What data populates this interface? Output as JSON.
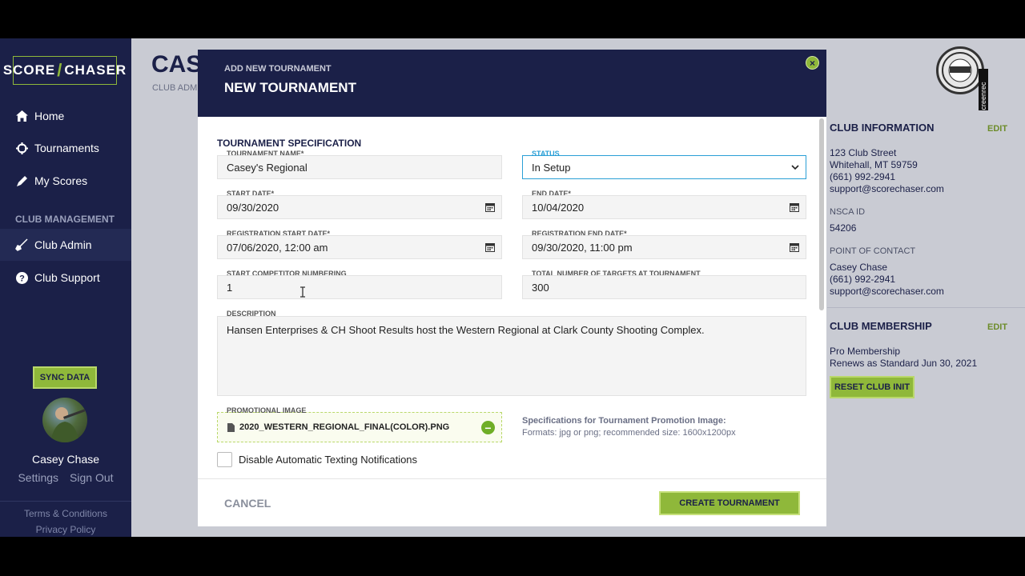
{
  "brand": {
    "left": "SCORE",
    "right": "CHASER",
    "accent": "#8fb83a",
    "navy": "#1b2048"
  },
  "sidebar": {
    "items": [
      {
        "label": "Home",
        "icon": "home-icon"
      },
      {
        "label": "Tournaments",
        "icon": "crosshair-icon"
      },
      {
        "label": "My Scores",
        "icon": "pencil-icon"
      }
    ],
    "section_heading": "CLUB MANAGEMENT",
    "management_items": [
      {
        "label": "Club Admin",
        "icon": "shotgun-icon"
      },
      {
        "label": "Club Support",
        "icon": "help-icon"
      }
    ],
    "sync_label": "SYNC DATA",
    "user_name": "Casey Chase",
    "settings_label": "Settings",
    "signout_label": "Sign Out",
    "terms_label": "Terms & Conditions",
    "privacy_label": "Privacy Policy"
  },
  "background": {
    "title": "CASE",
    "subtitle": "CLUB ADMI"
  },
  "right_panel": {
    "club_info_heading": "CLUB INFORMATION",
    "edit_label": "EDIT",
    "address1": "123 Club Street",
    "address2": "Whitehall, MT 59759",
    "phone": "(661) 992-2941",
    "email": "support@scorechaser.com",
    "nsca_label": "NSCA ID",
    "nsca_value": "54206",
    "poc_label": "POINT OF CONTACT",
    "poc_name": "Casey Chase",
    "poc_phone": "(661) 992-2941",
    "poc_email": "support@scorechaser.com",
    "membership_heading": "CLUB MEMBERSHIP",
    "membership_edit_label": "EDIT",
    "membership_type": "Pro Membership",
    "membership_renew": "Renews as Standard Jun 30, 2021",
    "reset_label": "RESET CLUB INIT",
    "rec_text": "screenrec"
  },
  "modal": {
    "eyebrow": "ADD NEW TOURNAMENT",
    "title": "NEW TOURNAMENT",
    "close_glyph": "×",
    "section_title": "TOURNAMENT SPECIFICATION",
    "fields": {
      "name": {
        "label": "TOURNAMENT NAME*",
        "value": "Casey's Regional"
      },
      "status": {
        "label": "STATUS",
        "value": "In Setup"
      },
      "start_date": {
        "label": "START DATE*",
        "value": "09/30/2020"
      },
      "end_date": {
        "label": "END DATE*",
        "value": "10/04/2020"
      },
      "reg_start": {
        "label": "REGISTRATION START DATE*",
        "value": "07/06/2020, 12:00 am"
      },
      "reg_end": {
        "label": "REGISTRATION END DATE*",
        "value": "09/30/2020, 11:00 pm"
      },
      "competitor_num": {
        "label": "START COMPETITOR NUMBERING",
        "value": "1"
      },
      "targets": {
        "label": "TOTAL NUMBER OF TARGETS AT TOURNAMENT",
        "value": "300"
      },
      "description": {
        "label": "DESCRIPTION",
        "value": "Hansen Enterprises & CH Shoot Results host the Western Regional at Clark County Shooting Complex."
      },
      "promo": {
        "label": "PROMOTIONAL IMAGE",
        "filename": "2020_WESTERN_REGIONAL_FINAL(COLOR).PNG"
      }
    },
    "promo_spec_title": "Specifications for Tournament Promotion Image:",
    "promo_spec_detail": "Formats: jpg or png; recommended size: 1600x1200px",
    "disable_texting_label": "Disable Automatic Texting Notifications",
    "disable_texting_checked": false,
    "cancel_label": "CANCEL",
    "create_label": "CREATE TOURNAMENT"
  }
}
